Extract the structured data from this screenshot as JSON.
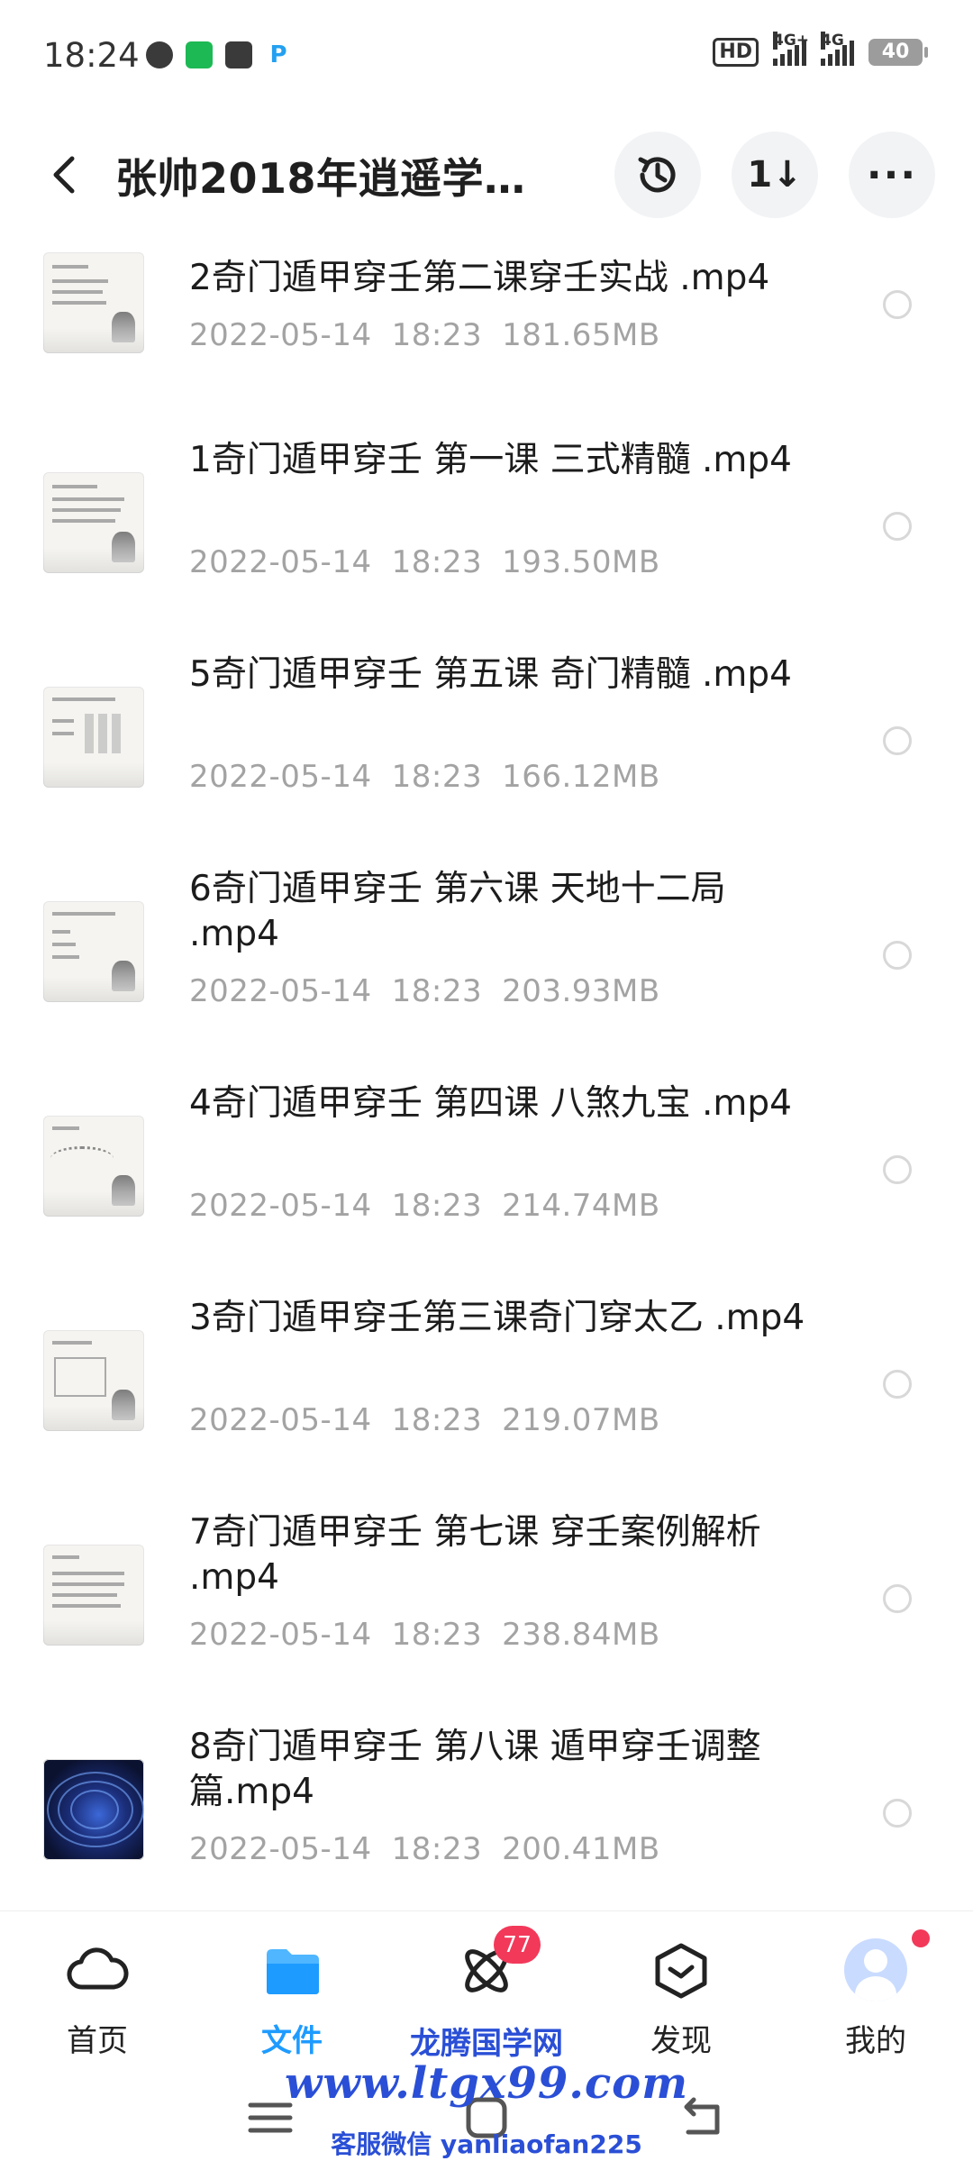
{
  "status_bar": {
    "time": "18:24",
    "app_icons": [
      "clock-icon",
      "iqiyi-icon",
      "mail-icon",
      "pay-icon"
    ],
    "network": "HD",
    "signal_1": "4G+",
    "signal_2": "4G",
    "battery": "40"
  },
  "header": {
    "title": "张帅2018年逍遥学…",
    "icons": [
      "back-icon",
      "history-icon",
      "sort-icon",
      "more-icon"
    ],
    "sort_symbol": "1↓",
    "more_symbol": "···"
  },
  "files": [
    {
      "name": "2奇门遁甲穿壬第二课穿壬实战 .mp4",
      "date": "2022-05-14",
      "time": "18:23",
      "size": "181.65MB"
    },
    {
      "name": "1奇门遁甲穿壬 第一课 三式精髓 .mp4",
      "date": "2022-05-14",
      "time": "18:23",
      "size": "193.50MB"
    },
    {
      "name": "5奇门遁甲穿壬 第五课 奇门精髓 .mp4",
      "date": "2022-05-14",
      "time": "18:23",
      "size": "166.12MB"
    },
    {
      "name": "6奇门遁甲穿壬 第六课 天地十二局 .mp4",
      "date": "2022-05-14",
      "time": "18:23",
      "size": "203.93MB"
    },
    {
      "name": "4奇门遁甲穿壬 第四课 八煞九宝 .mp4",
      "date": "2022-05-14",
      "time": "18:23",
      "size": "214.74MB"
    },
    {
      "name": "3奇门遁甲穿壬第三课奇门穿太乙 .mp4",
      "date": "2022-05-14",
      "time": "18:23",
      "size": "219.07MB"
    },
    {
      "name": "7奇门遁甲穿壬 第七课 穿壬案例解析 .mp4",
      "date": "2022-05-14",
      "time": "18:23",
      "size": "238.84MB"
    },
    {
      "name": "8奇门遁甲穿壬 第八课 遁甲穿壬调整篇.mp4",
      "date": "2022-05-14",
      "time": "18:23",
      "size": "200.41MB"
    }
  ],
  "bottom_nav": {
    "items": [
      {
        "label": "首页",
        "icon": "cloud-icon"
      },
      {
        "label": "文件",
        "icon": "folder-icon",
        "active": true
      },
      {
        "label": "",
        "icon": "atom-icon",
        "badge": "77"
      },
      {
        "label": "发现",
        "icon": "cube-icon"
      },
      {
        "label": "我的",
        "icon": "avatar-icon"
      }
    ]
  },
  "watermark": {
    "title": "龙腾国学网",
    "url": "www.ltgx99.com",
    "contact": "客服微信 yanliaofan225"
  },
  "colors": {
    "accent": "#1e9bff",
    "badge": "#f2395a",
    "meta_text": "#a3a3a3",
    "watermark": "#2a4fd6"
  }
}
